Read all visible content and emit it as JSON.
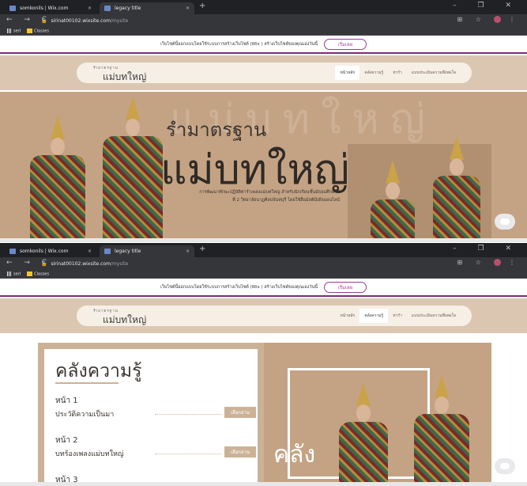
{
  "browser": {
    "tabs": [
      {
        "title": "somkonils | Wix.com",
        "close": "×"
      },
      {
        "title": "legacy title",
        "close": "×"
      }
    ],
    "new_tab": "+",
    "window_controls": "– ❐ ✕",
    "nav_buttons": "← → C",
    "url_domain": "sirinat00102.wixsite.com",
    "url_path": "/mysite",
    "bookmarks": [
      {
        "label": "serl",
        "icon": "apps-grid-icon"
      },
      {
        "label": "Classes",
        "icon": "classroom-icon"
      }
    ]
  },
  "wix_banner": {
    "text": "เว็บไซต์นี้ออกแบบโดยใช้ระบบการสร้างเว็บไซต์ (Wix ) สร้างเว็บไซต์ของคุณเองวันนี้",
    "button": "เริ่มเลย"
  },
  "site": {
    "logo_small": "รำมาตรฐาน",
    "logo_big": "แม่บทใหญ่",
    "nav": [
      "หน้าหลัก",
      "คลังความรู้",
      "ท่ารำ",
      "แบบประเมินความพึงพอใจ"
    ]
  },
  "hero": {
    "bg_text": "แม่บทใหญ่",
    "title_line1": "รำมาตรฐาน",
    "title_line2": "แม่บทใหญ่",
    "subtitle": "การพัฒนาทักษะปฏิบัติท่ารำเพลงแม่บทใหญ่ สำหรับนักเรียนชั้นมัธยมศึกษาปีที่ 2 วิทยาลัยนาฏศิลปจันทบุรี โดยใช้สื่อมัลติมีเดียออนไลน์"
  },
  "knowledge": {
    "title": "คลังความรู้",
    "entries": [
      {
        "page": "หน้า 1",
        "topic": "ประวัติความเป็นมา",
        "button": "เลือกอ่าน"
      },
      {
        "page": "หน้า 2",
        "topic": "บทร้องเพลงแม่บทใหญ่",
        "button": "เลือกอ่าน"
      },
      {
        "page": "หน้า 3",
        "topic": "",
        "button": ""
      }
    ],
    "image_word": "คลัง"
  },
  "colors": {
    "accent_purple": "#9a3a9c",
    "beige": "#dbc7b1",
    "hero_bg": "#c4a384",
    "button_beige": "#cbb297"
  }
}
